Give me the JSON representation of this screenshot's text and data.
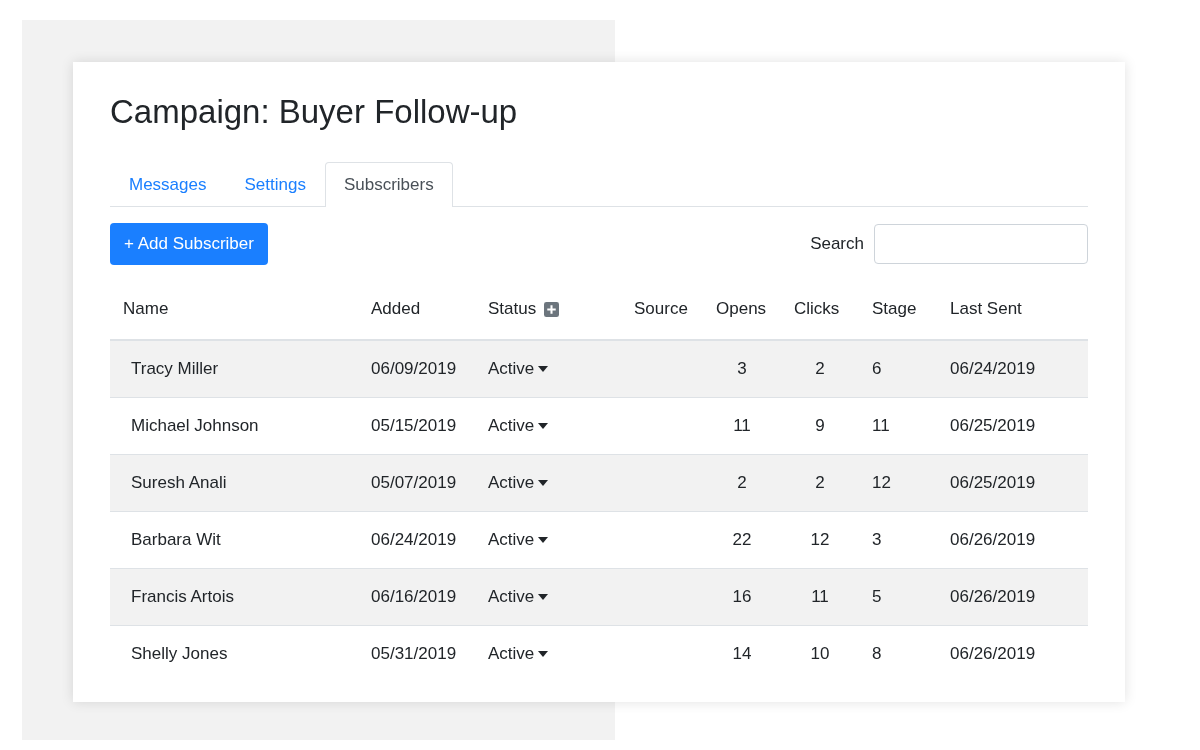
{
  "title": "Campaign: Buyer Follow-up",
  "tabs": [
    {
      "label": "Messages",
      "selected": false
    },
    {
      "label": "Settings",
      "selected": false
    },
    {
      "label": "Subscribers",
      "selected": true
    }
  ],
  "add_button": "+ Add Subscriber",
  "search": {
    "label": "Search"
  },
  "table": {
    "columns": [
      "Name",
      "Added",
      "Status",
      "Source",
      "Opens",
      "Clicks",
      "Stage",
      "Last Sent"
    ],
    "rows": [
      {
        "name": "Tracy Miller",
        "added": "06/09/2019",
        "status": "Active",
        "opens": "3",
        "clicks": "2",
        "stage": "6",
        "last_sent": "06/24/2019"
      },
      {
        "name": "Michael Johnson",
        "added": "05/15/2019",
        "status": "Active",
        "opens": "11",
        "clicks": "9",
        "stage": "11",
        "last_sent": "06/25/2019"
      },
      {
        "name": "Suresh Anali",
        "added": "05/07/2019",
        "status": "Active",
        "opens": "2",
        "clicks": "2",
        "stage": "12",
        "last_sent": "06/25/2019"
      },
      {
        "name": "Barbara Wit",
        "added": "06/24/2019",
        "status": "Active",
        "opens": "22",
        "clicks": "12",
        "stage": "3",
        "last_sent": "06/26/2019"
      },
      {
        "name": "Francis Artois",
        "added": "06/16/2019",
        "status": "Active",
        "opens": "16",
        "clicks": "11",
        "stage": "5",
        "last_sent": "06/26/2019"
      },
      {
        "name": "Shelly Jones",
        "added": "05/31/2019",
        "status": "Active",
        "opens": "14",
        "clicks": "10",
        "stage": "8",
        "last_sent": "06/26/2019"
      }
    ]
  }
}
